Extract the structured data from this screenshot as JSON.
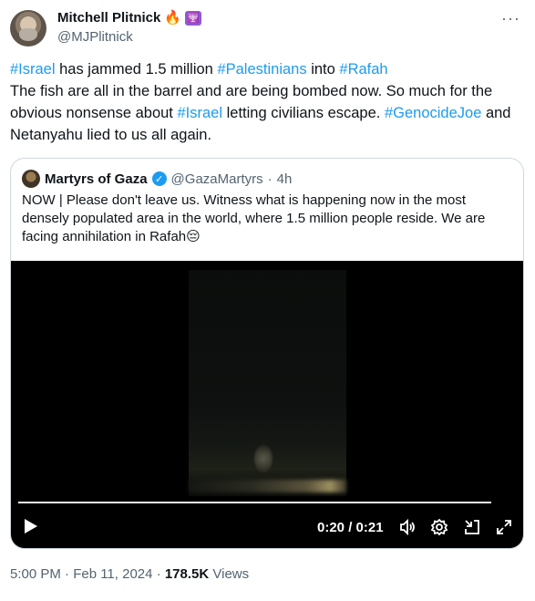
{
  "author": {
    "name": "Mitchell Plitnick",
    "name_emoji": "🔥",
    "badge_glyph": "🕎",
    "handle": "@MJPlitnick"
  },
  "tweet": {
    "segments": [
      {
        "text": "#Israel",
        "tag": true
      },
      {
        "text": " has jammed 1.5 million ",
        "tag": false
      },
      {
        "text": "#Palestinians",
        "tag": true
      },
      {
        "text": " into ",
        "tag": false
      },
      {
        "text": "#Rafah",
        "tag": true
      },
      {
        "text": "\nThe fish are all in the barrel and are being bombed now. So much for the obvious nonsense about ",
        "tag": false
      },
      {
        "text": "#Israel",
        "tag": true
      },
      {
        "text": " letting civilians escape. ",
        "tag": false
      },
      {
        "text": "#GenocideJoe",
        "tag": true
      },
      {
        "text": " and Netanyahu lied to us all again.",
        "tag": false
      }
    ]
  },
  "quote": {
    "name": "Martyrs of Gaza",
    "handle": "@GazaMartyrs",
    "separator": "·",
    "age": "4h",
    "text": "NOW | Please don't leave us. Witness what is happening now in the most densely populated area in the world, where 1.5 million people reside. We are facing annihilation in Rafah",
    "text_emoji": "😔"
  },
  "video": {
    "time": "0:20 / 0:21",
    "progress_fraction": 0.95
  },
  "footer": {
    "timestamp": "5:00 PM · Feb 11, 2024",
    "separator": "·",
    "views_count": "178.5K",
    "views_label": "Views"
  },
  "colors": {
    "link": "#1d9bf0",
    "muted": "#536471",
    "text": "#0f1419",
    "border": "#cfd9de"
  },
  "icons": [
    "more-icon",
    "verified-icon",
    "play-icon",
    "volume-icon",
    "settings-icon",
    "minimize-icon",
    "fullscreen-icon"
  ]
}
